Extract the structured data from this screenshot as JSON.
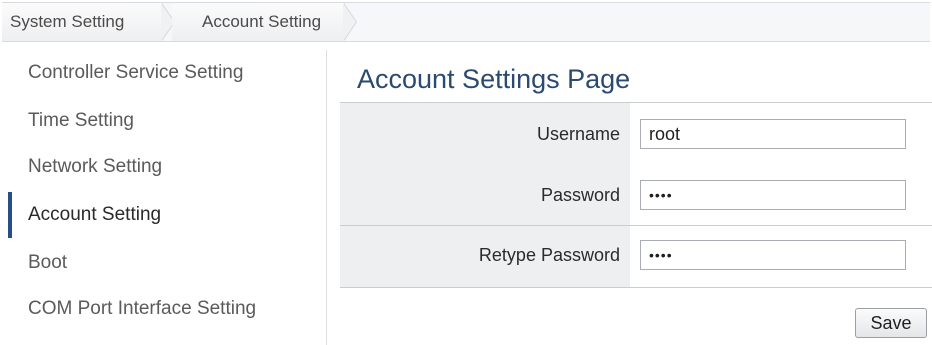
{
  "breadcrumb": {
    "items": [
      "System Setting",
      "Account Setting"
    ]
  },
  "sidebar": {
    "items": [
      {
        "label": "Controller Service Setting",
        "active": false
      },
      {
        "label": "Time Setting",
        "active": false
      },
      {
        "label": "Network Setting",
        "active": false
      },
      {
        "label": "Account Setting",
        "active": true
      },
      {
        "label": "Boot",
        "active": false
      },
      {
        "label": "COM Port Interface Setting",
        "active": false
      }
    ]
  },
  "main": {
    "title": "Account Settings Page",
    "form": {
      "username_label": "Username",
      "username_value": "root",
      "password_label": "Password",
      "password_value": "••••",
      "retype_label": "Retype Password",
      "retype_value": "••••"
    },
    "save_label": "Save"
  },
  "colors": {
    "accent": "#264f87",
    "title": "#2a4a72",
    "label_bg": "#eeeff1"
  }
}
